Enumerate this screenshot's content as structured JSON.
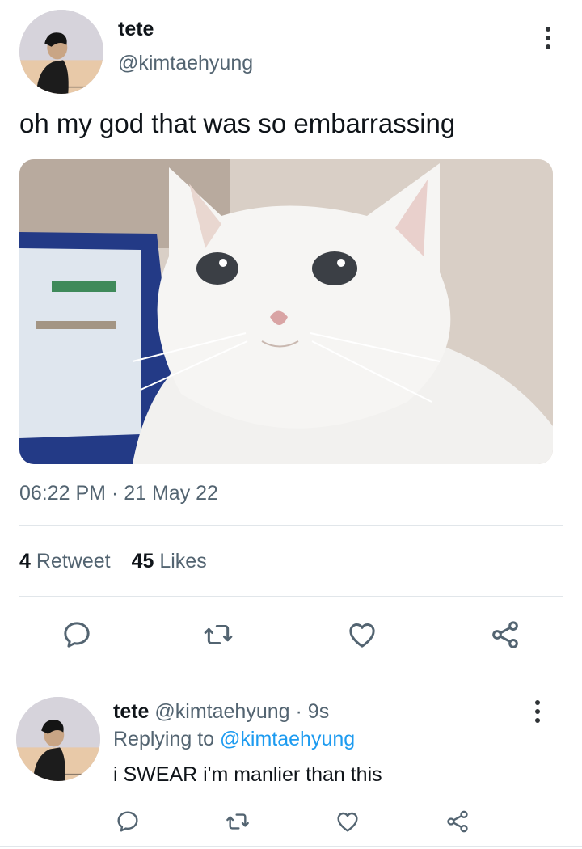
{
  "tweet": {
    "display_name": "tete",
    "handle": "@kimtaehyung",
    "text": "oh my god that was so embarrassing",
    "timestamp": "06:22 PM · 21 May 22",
    "retweet_count": "4",
    "retweet_label": "Retweet",
    "like_count": "45",
    "like_label": "Likes"
  },
  "reply": {
    "display_name": "tete",
    "handle": "@kimtaehyung",
    "time": "· 9s",
    "replying_prefix": "Replying to",
    "replying_to": "@kimtaehyung",
    "text": "i SWEAR i'm manlier than this"
  },
  "icons": {
    "reply": "reply-icon",
    "retweet": "retweet-icon",
    "like": "heart-icon",
    "share": "share-icon",
    "more": "more-vertical-icon"
  },
  "colors": {
    "text": "#0f1419",
    "secondary": "#536471",
    "link": "#1d9bf0",
    "divider": "#e1e6ea"
  }
}
